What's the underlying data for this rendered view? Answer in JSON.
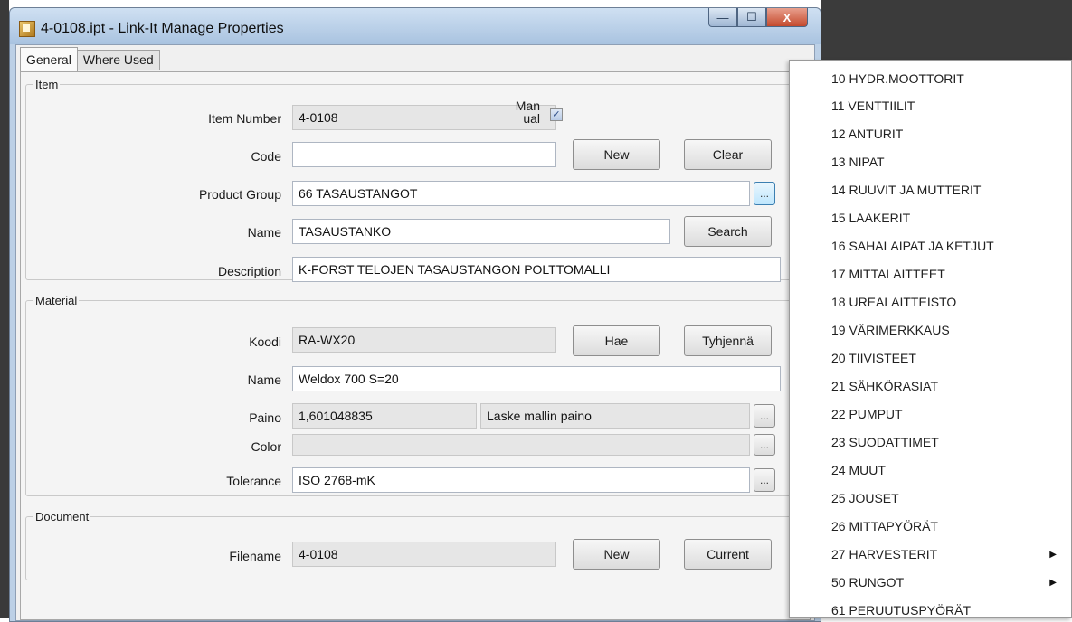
{
  "window": {
    "title": "4-0108.ipt - Link-It Manage Properties",
    "min_glyph": "—",
    "max_glyph": "☐",
    "close_glyph": "X"
  },
  "tabs": [
    {
      "label": "General"
    },
    {
      "label": "Where Used"
    }
  ],
  "item": {
    "legend": "Item",
    "item_number": {
      "label": "Item Number",
      "value": "4-0108"
    },
    "manual": {
      "label_line1": "Man",
      "label_line2": "ual",
      "checked": true,
      "check_glyph": "✓"
    },
    "code": {
      "label": "Code",
      "value": ""
    },
    "new_button": "New",
    "clear_button": "Clear",
    "product_group": {
      "label": "Product Group",
      "value": "66 TASAUSTANGOT"
    },
    "name": {
      "label": "Name",
      "value": "TASAUSTANKO"
    },
    "search_button": "Search",
    "description": {
      "label": "Description",
      "value": "K-FORST TELOJEN TASAUSTANGON POLTTOMALLI"
    }
  },
  "material": {
    "legend": "Material",
    "koodi": {
      "label": "Koodi",
      "value": "RA-WX20"
    },
    "hae_button": "Hae",
    "tyhjenna_button": "Tyhjennä",
    "name": {
      "label": "Name",
      "value": "Weldox 700 S=20"
    },
    "paino": {
      "label": "Paino",
      "value": "1,601048835",
      "extra": "Laske mallin paino"
    },
    "color": {
      "label": "Color",
      "value": ""
    },
    "tolerance": {
      "label": "Tolerance",
      "value": "ISO 2768-mK"
    }
  },
  "document": {
    "legend": "Document",
    "filename": {
      "label": "Filename",
      "value": "4-0108"
    },
    "new_button": "New",
    "current_button": "Current"
  },
  "ellipsis": "...",
  "dropdown": {
    "items": [
      {
        "label": "10 HYDR.MOOTTORIT",
        "submenu": false
      },
      {
        "label": "11 VENTTIILIT",
        "submenu": false
      },
      {
        "label": "12 ANTURIT",
        "submenu": false
      },
      {
        "label": "13 NIPAT",
        "submenu": false
      },
      {
        "label": "14 RUUVIT JA MUTTERIT",
        "submenu": false
      },
      {
        "label": "15 LAAKERIT",
        "submenu": false
      },
      {
        "label": "16 SAHALAIPAT JA KETJUT",
        "submenu": false
      },
      {
        "label": "17 MITTALAITTEET",
        "submenu": false
      },
      {
        "label": "18 UREALAITTEISTO",
        "submenu": false
      },
      {
        "label": "19 VÄRIMERKKAUS",
        "submenu": false
      },
      {
        "label": "20 TIIVISTEET",
        "submenu": false
      },
      {
        "label": "21 SÄHKÖRASIAT",
        "submenu": false
      },
      {
        "label": "22 PUMPUT",
        "submenu": false
      },
      {
        "label": "23 SUODATTIMET",
        "submenu": false
      },
      {
        "label": "24 MUUT",
        "submenu": false
      },
      {
        "label": "25 JOUSET",
        "submenu": false
      },
      {
        "label": "26 MITTAPYÖRÄT",
        "submenu": false
      },
      {
        "label": "27 HARVESTERIT",
        "submenu": true
      },
      {
        "label": "50 RUNGOT",
        "submenu": true
      },
      {
        "label": "61 PERUUTUSPYÖRÄT",
        "submenu": false
      }
    ],
    "submenu_arrow": "▶"
  }
}
